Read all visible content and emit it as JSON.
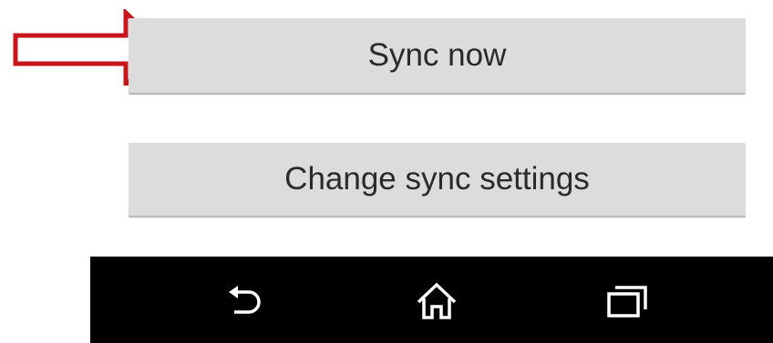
{
  "buttons": {
    "sync_now": "Sync now",
    "change_sync_settings": "Change sync settings"
  },
  "annotation": {
    "icon": "arrow-right-outline-icon",
    "color": "#c8161d"
  },
  "navbar": {
    "background": "#000000",
    "icons": [
      "back-icon",
      "home-icon",
      "recent-apps-icon"
    ]
  }
}
